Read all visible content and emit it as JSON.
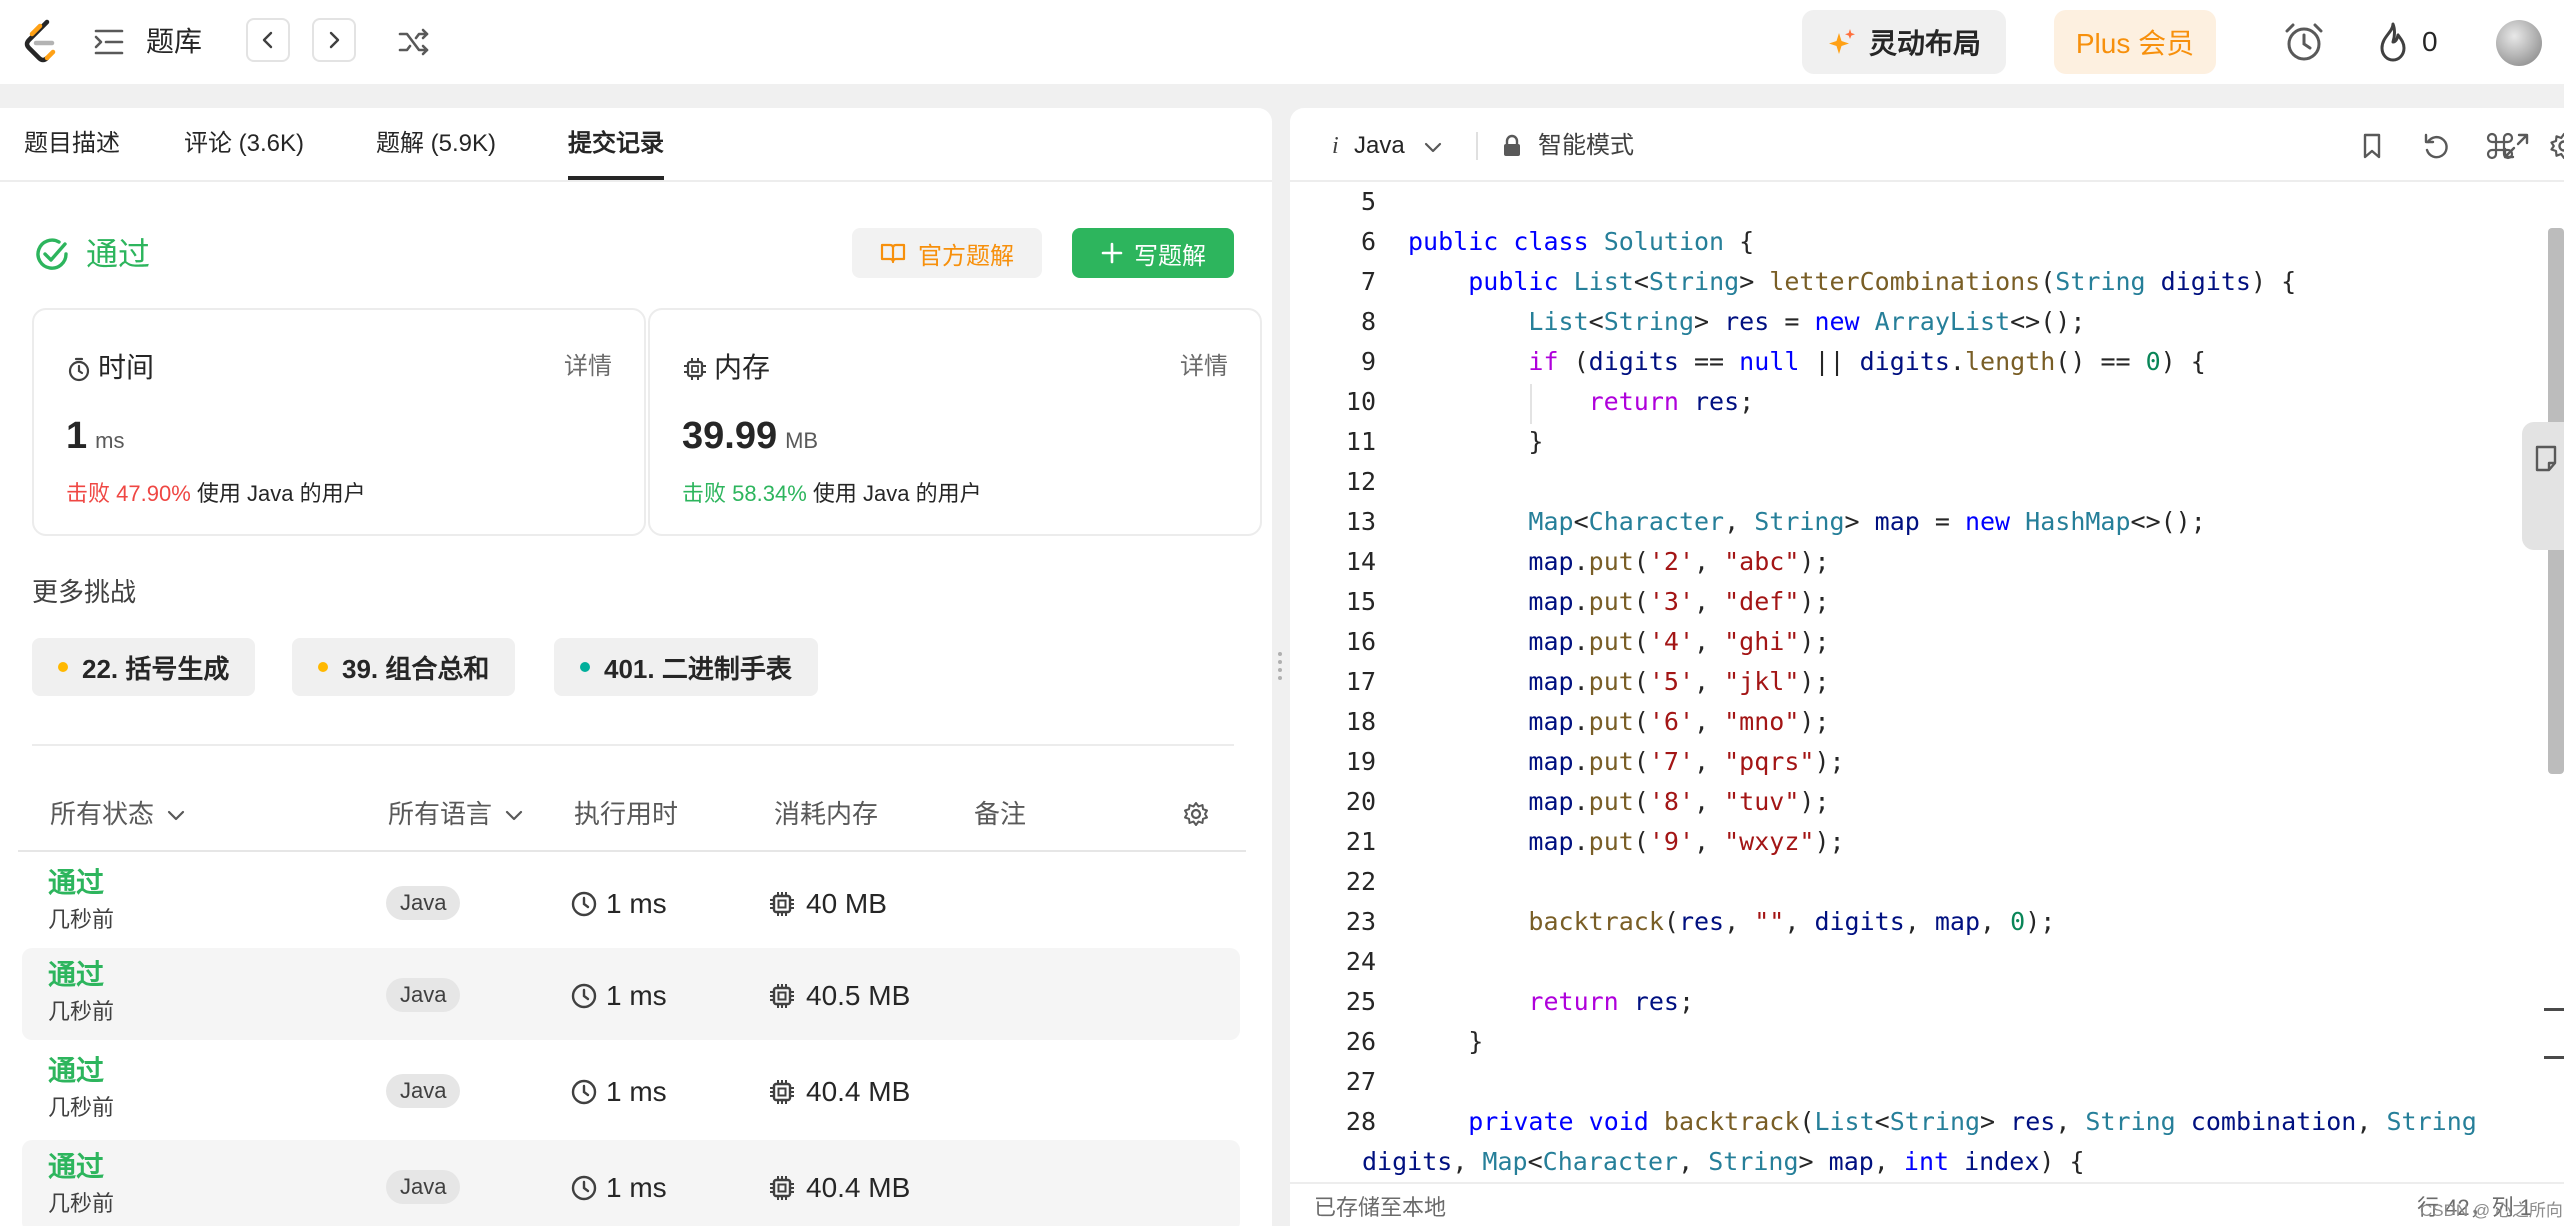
{
  "topbar": {
    "title": "题库",
    "layout_label": "灵动布局",
    "plus_label": "Plus 会员",
    "fire_count": "0"
  },
  "tabs": [
    {
      "label": "题目描述"
    },
    {
      "label": "评论 (3.6K)"
    },
    {
      "label": "题解 (5.9K)"
    },
    {
      "label": "提交记录",
      "active": true
    }
  ],
  "result": {
    "status": "通过",
    "official_solution": "官方题解",
    "write_solution": "写题解"
  },
  "stats": {
    "time": {
      "label": "时间",
      "detail": "详情",
      "value": "1",
      "unit": "ms",
      "beat_prefix": "击败",
      "beat_pct": "47.90%",
      "beat_suffix": "使用 Java 的用户"
    },
    "memory": {
      "label": "内存",
      "detail": "详情",
      "value": "39.99",
      "unit": "MB",
      "beat_prefix": "击败",
      "beat_pct": "58.34%",
      "beat_suffix": "使用 Java 的用户"
    }
  },
  "more": {
    "title": "更多挑战",
    "items": [
      {
        "label": "22. 括号生成",
        "dot_color": "#ffb800"
      },
      {
        "label": "39. 组合总和",
        "dot_color": "#ffb800"
      },
      {
        "label": "401. 二进制手表",
        "dot_color": "#00af9b"
      }
    ]
  },
  "table": {
    "headers": {
      "status": "所有状态",
      "lang": "所有语言",
      "runtime": "执行用时",
      "memory": "消耗内存",
      "note": "备注"
    },
    "rows": [
      {
        "status": "通过",
        "time_ago": "几秒前",
        "lang": "Java",
        "runtime": "1 ms",
        "memory": "40 MB"
      },
      {
        "status": "通过",
        "time_ago": "几秒前",
        "lang": "Java",
        "runtime": "1 ms",
        "memory": "40.5 MB"
      },
      {
        "status": "通过",
        "time_ago": "几秒前",
        "lang": "Java",
        "runtime": "1 ms",
        "memory": "40.4 MB"
      },
      {
        "status": "通过",
        "time_ago": "几秒前",
        "lang": "Java",
        "runtime": "1 ms",
        "memory": "40.4 MB"
      }
    ]
  },
  "editor": {
    "lang_prefix": "i",
    "language": "Java",
    "mode": "智能模式",
    "saved": "已存储至本地",
    "cursor": "行 42，列 1",
    "watermark": "CSDN @ 心之所向",
    "first_line": 5,
    "lines": [
      [],
      [
        [
          "kw",
          "public"
        ],
        [
          "p",
          " "
        ],
        [
          "kw",
          "class"
        ],
        [
          "p",
          " "
        ],
        [
          "type",
          "Solution"
        ],
        [
          "p",
          " {"
        ]
      ],
      [
        [
          "p",
          "    "
        ],
        [
          "kw",
          "public"
        ],
        [
          "p",
          " "
        ],
        [
          "type",
          "List"
        ],
        [
          "p",
          "<"
        ],
        [
          "type",
          "String"
        ],
        [
          "p",
          "> "
        ],
        [
          "fn",
          "letterCombinations"
        ],
        [
          "p",
          "("
        ],
        [
          "type",
          "String"
        ],
        [
          "p",
          " "
        ],
        [
          "var",
          "digits"
        ],
        [
          "p",
          ") {"
        ]
      ],
      [
        [
          "p",
          "        "
        ],
        [
          "type",
          "List"
        ],
        [
          "p",
          "<"
        ],
        [
          "type",
          "String"
        ],
        [
          "p",
          "> "
        ],
        [
          "var",
          "res"
        ],
        [
          "p",
          " = "
        ],
        [
          "kw",
          "new"
        ],
        [
          "p",
          " "
        ],
        [
          "type",
          "ArrayList"
        ],
        [
          "p",
          "<>();"
        ]
      ],
      [
        [
          "p",
          "        "
        ],
        [
          "kw2",
          "if"
        ],
        [
          "p",
          " ("
        ],
        [
          "var",
          "digits"
        ],
        [
          "p",
          " == "
        ],
        [
          "kw",
          "null"
        ],
        [
          "p",
          " || "
        ],
        [
          "var",
          "digits"
        ],
        [
          "p",
          "."
        ],
        [
          "fn",
          "length"
        ],
        [
          "p",
          "() == "
        ],
        [
          "num",
          "0"
        ],
        [
          "p",
          ") {"
        ]
      ],
      [
        [
          "p",
          "            "
        ],
        [
          "kw2",
          "return"
        ],
        [
          "p",
          " "
        ],
        [
          "var",
          "res"
        ],
        [
          "p",
          ";"
        ]
      ],
      [
        [
          "p",
          "        }"
        ]
      ],
      [],
      [
        [
          "p",
          "        "
        ],
        [
          "type",
          "Map"
        ],
        [
          "p",
          "<"
        ],
        [
          "type",
          "Character"
        ],
        [
          "p",
          ", "
        ],
        [
          "type",
          "String"
        ],
        [
          "p",
          "> "
        ],
        [
          "var",
          "map"
        ],
        [
          "p",
          " = "
        ],
        [
          "kw",
          "new"
        ],
        [
          "p",
          " "
        ],
        [
          "type",
          "HashMap"
        ],
        [
          "p",
          "<>();"
        ]
      ],
      [
        [
          "p",
          "        "
        ],
        [
          "var",
          "map"
        ],
        [
          "p",
          "."
        ],
        [
          "fn",
          "put"
        ],
        [
          "p",
          "("
        ],
        [
          "str",
          "'2'"
        ],
        [
          "p",
          ", "
        ],
        [
          "str",
          "\"abc\""
        ],
        [
          "p",
          ");"
        ]
      ],
      [
        [
          "p",
          "        "
        ],
        [
          "var",
          "map"
        ],
        [
          "p",
          "."
        ],
        [
          "fn",
          "put"
        ],
        [
          "p",
          "("
        ],
        [
          "str",
          "'3'"
        ],
        [
          "p",
          ", "
        ],
        [
          "str",
          "\"def\""
        ],
        [
          "p",
          ");"
        ]
      ],
      [
        [
          "p",
          "        "
        ],
        [
          "var",
          "map"
        ],
        [
          "p",
          "."
        ],
        [
          "fn",
          "put"
        ],
        [
          "p",
          "("
        ],
        [
          "str",
          "'4'"
        ],
        [
          "p",
          ", "
        ],
        [
          "str",
          "\"ghi\""
        ],
        [
          "p",
          ");"
        ]
      ],
      [
        [
          "p",
          "        "
        ],
        [
          "var",
          "map"
        ],
        [
          "p",
          "."
        ],
        [
          "fn",
          "put"
        ],
        [
          "p",
          "("
        ],
        [
          "str",
          "'5'"
        ],
        [
          "p",
          ", "
        ],
        [
          "str",
          "\"jkl\""
        ],
        [
          "p",
          ");"
        ]
      ],
      [
        [
          "p",
          "        "
        ],
        [
          "var",
          "map"
        ],
        [
          "p",
          "."
        ],
        [
          "fn",
          "put"
        ],
        [
          "p",
          "("
        ],
        [
          "str",
          "'6'"
        ],
        [
          "p",
          ", "
        ],
        [
          "str",
          "\"mno\""
        ],
        [
          "p",
          ");"
        ]
      ],
      [
        [
          "p",
          "        "
        ],
        [
          "var",
          "map"
        ],
        [
          "p",
          "."
        ],
        [
          "fn",
          "put"
        ],
        [
          "p",
          "("
        ],
        [
          "str",
          "'7'"
        ],
        [
          "p",
          ", "
        ],
        [
          "str",
          "\"pqrs\""
        ],
        [
          "p",
          ");"
        ]
      ],
      [
        [
          "p",
          "        "
        ],
        [
          "var",
          "map"
        ],
        [
          "p",
          "."
        ],
        [
          "fn",
          "put"
        ],
        [
          "p",
          "("
        ],
        [
          "str",
          "'8'"
        ],
        [
          "p",
          ", "
        ],
        [
          "str",
          "\"tuv\""
        ],
        [
          "p",
          ");"
        ]
      ],
      [
        [
          "p",
          "        "
        ],
        [
          "var",
          "map"
        ],
        [
          "p",
          "."
        ],
        [
          "fn",
          "put"
        ],
        [
          "p",
          "("
        ],
        [
          "str",
          "'9'"
        ],
        [
          "p",
          ", "
        ],
        [
          "str",
          "\"wxyz\""
        ],
        [
          "p",
          ");"
        ]
      ],
      [],
      [
        [
          "p",
          "        "
        ],
        [
          "fn",
          "backtrack"
        ],
        [
          "p",
          "("
        ],
        [
          "var",
          "res"
        ],
        [
          "p",
          ", "
        ],
        [
          "str",
          "\"\""
        ],
        [
          "p",
          ", "
        ],
        [
          "var",
          "digits"
        ],
        [
          "p",
          ", "
        ],
        [
          "var",
          "map"
        ],
        [
          "p",
          ", "
        ],
        [
          "num",
          "0"
        ],
        [
          "p",
          ");"
        ]
      ],
      [],
      [
        [
          "p",
          "        "
        ],
        [
          "kw2",
          "return"
        ],
        [
          "p",
          " "
        ],
        [
          "var",
          "res"
        ],
        [
          "p",
          ";"
        ]
      ],
      [
        [
          "p",
          "    }"
        ]
      ],
      [],
      [
        [
          "p",
          "    "
        ],
        [
          "kw",
          "private"
        ],
        [
          "p",
          " "
        ],
        [
          "kw",
          "void"
        ],
        [
          "p",
          " "
        ],
        [
          "fn",
          "backtrack"
        ],
        [
          "p",
          "("
        ],
        [
          "type",
          "List"
        ],
        [
          "p",
          "<"
        ],
        [
          "type",
          "String"
        ],
        [
          "p",
          "> "
        ],
        [
          "var",
          "res"
        ],
        [
          "p",
          ", "
        ],
        [
          "type",
          "String"
        ],
        [
          "p",
          " "
        ],
        [
          "var",
          "combination"
        ],
        [
          "p",
          ", "
        ],
        [
          "type",
          "String"
        ]
      ],
      [
        [
          "var",
          "digits"
        ],
        [
          "p",
          ", "
        ],
        [
          "type",
          "Map"
        ],
        [
          "p",
          "<"
        ],
        [
          "type",
          "Character"
        ],
        [
          "p",
          ", "
        ],
        [
          "type",
          "String"
        ],
        [
          "p",
          "> "
        ],
        [
          "var",
          "map"
        ],
        [
          "p",
          ", "
        ],
        [
          "kw",
          "int"
        ],
        [
          "p",
          " "
        ],
        [
          "var",
          "index"
        ],
        [
          "p",
          ") {"
        ]
      ]
    ]
  }
}
